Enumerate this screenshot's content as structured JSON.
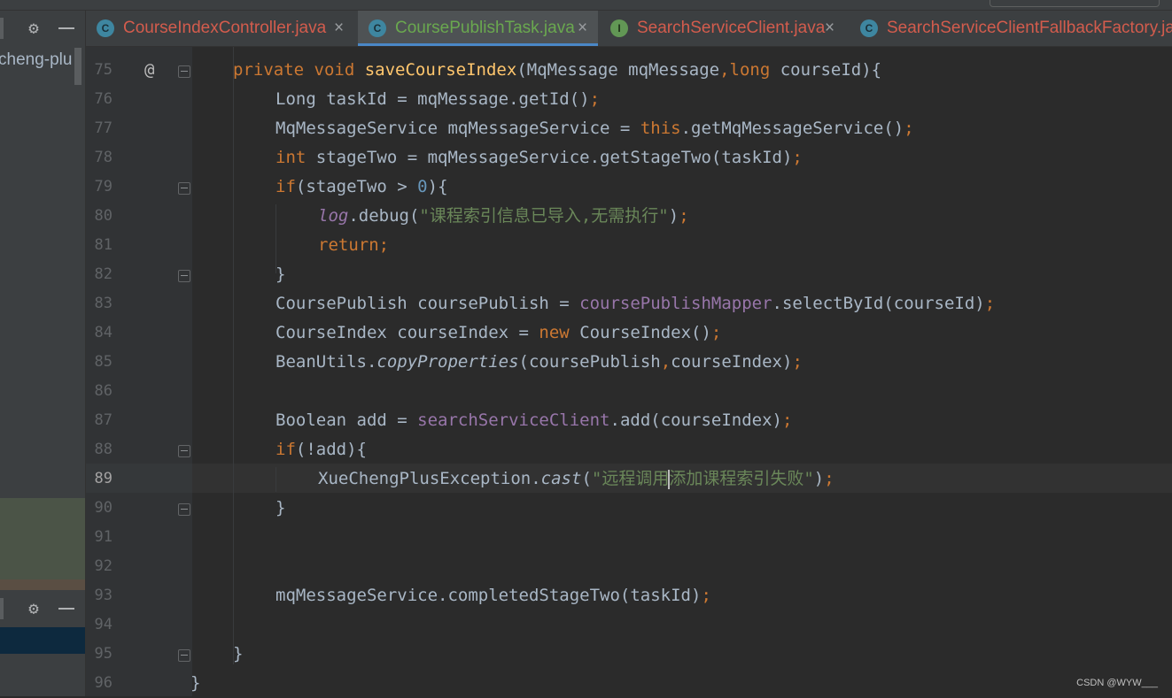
{
  "tabs": [
    {
      "label": "CourseIndexController.java",
      "icon": "class-icon",
      "color": "#d35c4d",
      "active": false
    },
    {
      "label": "CoursePublishTask.java",
      "icon": "class-icon",
      "color": "#6aa84f",
      "active": true
    },
    {
      "label": "SearchServiceClient.java",
      "icon": "interface-icon",
      "color": "#d35c4d",
      "active": false
    },
    {
      "label": "SearchServiceClientFallbackFactory.java",
      "icon": "class-icon",
      "color": "#d35c4d",
      "active": false
    }
  ],
  "sidebar": {
    "project_label": "cheng-plus-"
  },
  "editor": {
    "current_line": "89",
    "lines": [
      {
        "num": "75",
        "code": "private void saveCourseIndex(MqMessage mqMessage,long courseId){"
      },
      {
        "num": "76",
        "code": "Long taskId = mqMessage.getId();"
      },
      {
        "num": "77",
        "code": "MqMessageService mqMessageService = this.getMqMessageService();"
      },
      {
        "num": "78",
        "code": "int stageTwo = mqMessageService.getStageTwo(taskId);"
      },
      {
        "num": "79",
        "code": "if(stageTwo > 0){"
      },
      {
        "num": "80",
        "code": "log.debug(\"课程索引信息已导入,无需执行\");"
      },
      {
        "num": "81",
        "code": "return;"
      },
      {
        "num": "82",
        "code": "}"
      },
      {
        "num": "83",
        "code": "CoursePublish coursePublish = coursePublishMapper.selectById(courseId);"
      },
      {
        "num": "84",
        "code": "CourseIndex courseIndex = new CourseIndex();"
      },
      {
        "num": "85",
        "code": "BeanUtils.copyProperties(coursePublish,courseIndex);"
      },
      {
        "num": "86",
        "code": ""
      },
      {
        "num": "87",
        "code": "Boolean add = searchServiceClient.add(courseIndex);"
      },
      {
        "num": "88",
        "code": "if(!add){"
      },
      {
        "num": "89",
        "code": "XueChengPlusException.cast(\"远程调用添加课程索引失败\");"
      },
      {
        "num": "90",
        "code": "}"
      },
      {
        "num": "91",
        "code": ""
      },
      {
        "num": "92",
        "code": ""
      },
      {
        "num": "93",
        "code": "mqMessageService.completedStageTwo(taskId);"
      },
      {
        "num": "94",
        "code": ""
      },
      {
        "num": "95",
        "code": "}"
      },
      {
        "num": "96",
        "code": "}"
      }
    ]
  },
  "watermark": "CSDN @WYW___",
  "colors": {
    "keyword": "#cc7832",
    "method_decl": "#ffc66d",
    "field": "#9876aa",
    "number": "#6897bb",
    "string": "#6a8759",
    "text": "#a9b7c6",
    "background": "#2b2b2b",
    "gutter": "#313335",
    "active_tab_underline": "#4a88c7"
  }
}
